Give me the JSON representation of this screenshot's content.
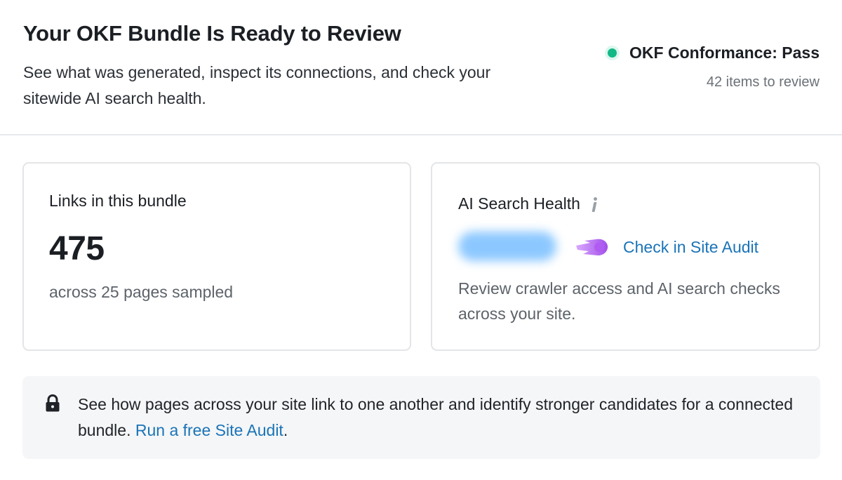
{
  "header": {
    "title": "Your OKF Bundle Is Ready to Review",
    "subtitle": "See what was generated, inspect its connections, and check your sitewide AI search health.",
    "conformance": {
      "label": "OKF Conformance: Pass",
      "status_color": "#12b886",
      "review_count": "42 items to review"
    }
  },
  "links_card": {
    "title": "Links in this bundle",
    "count": "475",
    "note": "across 25 pages sampled"
  },
  "health_card": {
    "title": "AI Search Health",
    "info_icon": "info-icon",
    "score_hidden": true,
    "score_blur_color": "#8cc8ff",
    "link_icon": "comet-icon",
    "link_label": "Check in Site Audit",
    "description": "Review crawler access and AI search checks across your site."
  },
  "banner": {
    "icon": "lock-icon",
    "text": "See how pages across your site link to one another and identify stronger candidates for a connected bundle. ",
    "link_label": "Run a free Site Audit",
    "trailing": "."
  },
  "colors": {
    "link": "#1a74b8",
    "comet_accent": "#b46cf0"
  }
}
